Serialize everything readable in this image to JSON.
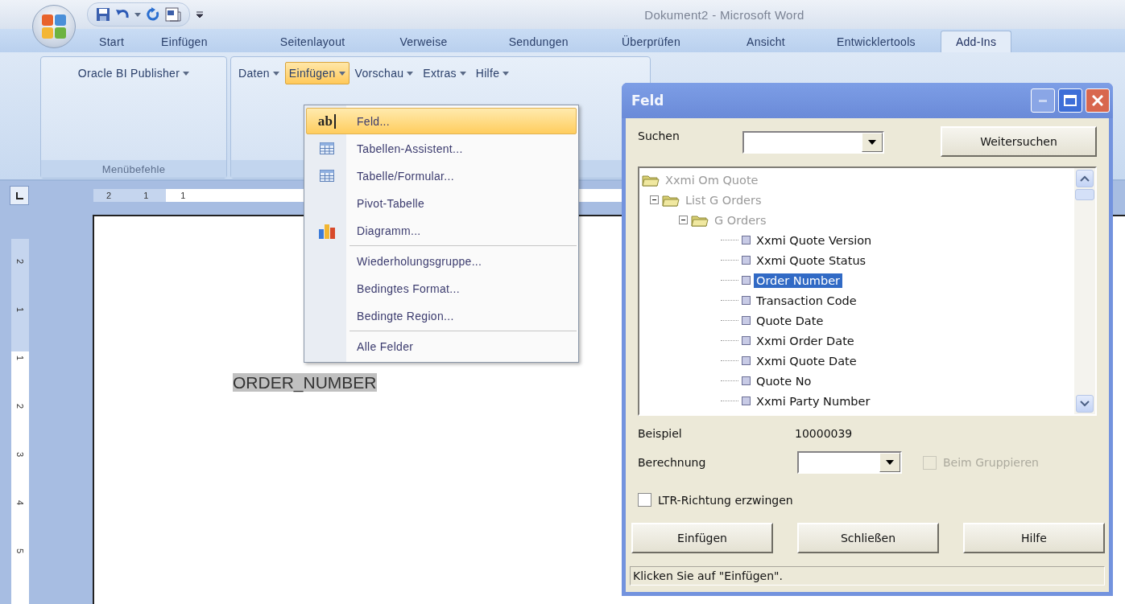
{
  "window": {
    "title": "Dokument2 - Microsoft Word"
  },
  "ribbon_tabs": [
    {
      "label": "Start",
      "selected": false
    },
    {
      "label": "Einfügen",
      "selected": false
    },
    {
      "label": "Seitenlayout",
      "selected": false
    },
    {
      "label": "Verweise",
      "selected": false
    },
    {
      "label": "Sendungen",
      "selected": false
    },
    {
      "label": "Überprüfen",
      "selected": false
    },
    {
      "label": "Ansicht",
      "selected": false
    },
    {
      "label": "Entwicklertools",
      "selected": false
    },
    {
      "label": "Add-Ins",
      "selected": true
    }
  ],
  "ribbon_groups": [
    {
      "label": "Menübefehle",
      "buttons": [
        {
          "label": "Oracle BI Publisher",
          "pressed": false
        }
      ]
    },
    {
      "buttons": [
        {
          "label": "Daten",
          "pressed": false
        },
        {
          "label": "Einfügen",
          "pressed": true
        },
        {
          "label": "Vorschau",
          "pressed": false
        },
        {
          "label": "Extras",
          "pressed": false
        },
        {
          "label": "Hilfe",
          "pressed": false
        }
      ]
    }
  ],
  "horizontal_ruler": {
    "labels": [
      "2",
      "1",
      "1"
    ]
  },
  "vertical_ruler": {
    "labels": [
      "2",
      "1",
      "1",
      "2",
      "3",
      "4",
      "5"
    ]
  },
  "document": {
    "field_text": "ORDER_NUMBER"
  },
  "insert_menu": {
    "items": [
      {
        "label": "Feld...",
        "kind": "field",
        "icon_text": "ab",
        "selected": true,
        "separator_before": false
      },
      {
        "label": "Tabellen-Assistent...",
        "kind": "table",
        "selected": false,
        "separator_before": false
      },
      {
        "label": "Tabelle/Formular...",
        "kind": "table",
        "selected": false,
        "separator_before": false
      },
      {
        "label": "Pivot-Tabelle",
        "kind": "plain",
        "selected": false,
        "separator_before": false
      },
      {
        "label": "Diagramm...",
        "kind": "chart",
        "selected": false,
        "separator_before": false
      },
      {
        "label": "Wiederholungsgruppe...",
        "kind": "plain",
        "selected": false,
        "separator_before": true
      },
      {
        "label": "Bedingtes Format...",
        "kind": "plain",
        "selected": false,
        "separator_before": false
      },
      {
        "label": "Bedingte Region...",
        "kind": "plain",
        "selected": false,
        "separator_before": false
      },
      {
        "label": "Alle Felder",
        "kind": "plain",
        "selected": false,
        "separator_before": true
      }
    ]
  },
  "dialog": {
    "title": "Feld",
    "search": {
      "label": "Suchen"
    },
    "find_next_button": "Weitersuchen",
    "tree": [
      {
        "kind": "folder",
        "label": "Xxmi Om Quote",
        "selected": false,
        "children": [
          {
            "kind": "folder",
            "label": "List G Orders",
            "expanded": true,
            "selected": false,
            "children": [
              {
                "kind": "folder",
                "label": "G Orders",
                "expanded": true,
                "selected": false,
                "children": [
                  {
                    "kind": "field",
                    "label": "Xxmi Quote Version",
                    "selected": false
                  },
                  {
                    "kind": "field",
                    "label": "Xxmi Quote Status",
                    "selected": false
                  },
                  {
                    "kind": "field",
                    "label": "Order Number",
                    "selected": true
                  },
                  {
                    "kind": "field",
                    "label": "Transaction Code",
                    "selected": false
                  },
                  {
                    "kind": "field",
                    "label": "Quote Date",
                    "selected": false
                  },
                  {
                    "kind": "field",
                    "label": "Xxmi Order Date",
                    "selected": false
                  },
                  {
                    "kind": "field",
                    "label": "Xxmi Quote Date",
                    "selected": false
                  },
                  {
                    "kind": "field",
                    "label": "Quote No",
                    "selected": false
                  },
                  {
                    "kind": "field",
                    "label": "Xxmi Party Number",
                    "selected": false
                  }
                ]
              }
            ]
          }
        ]
      }
    ],
    "example": {
      "label": "Beispiel",
      "value": "10000039"
    },
    "calculation": {
      "label": "Berechnung"
    },
    "group_option": {
      "label": "Beim Gruppieren",
      "checked": false,
      "disabled": true
    },
    "ltr_option": {
      "label": "LTR-Richtung erzwingen",
      "checked": false,
      "disabled": false
    },
    "buttons": [
      "Einfügen",
      "Schließen",
      "Hilfe"
    ],
    "status": "Klicken Sie auf \"Einfügen\"."
  }
}
